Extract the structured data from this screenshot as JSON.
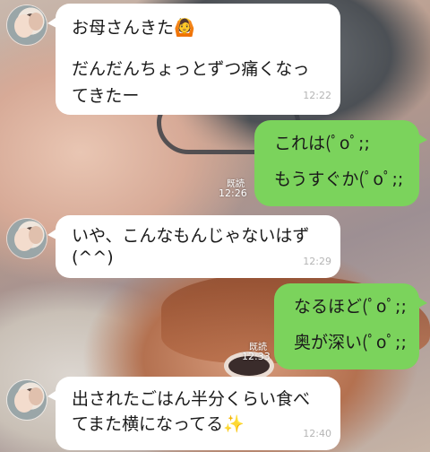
{
  "messages": [
    {
      "side": "left",
      "lines": [
        "お母さんきた🙆",
        "だんだんちょっとずつ痛くなっ",
        "てきたー"
      ],
      "time": "12:22"
    },
    {
      "side": "right",
      "lines": [
        "これは(ﾟoﾟ;;",
        "もうすぐか(ﾟoﾟ;;"
      ],
      "time": "12:26",
      "read": "既読"
    },
    {
      "side": "left",
      "lines": [
        "いや、こんなもんじゃないはず",
        "(^^)"
      ],
      "time": "12:29"
    },
    {
      "side": "right",
      "lines": [
        "なるほど(ﾟoﾟ;;",
        "奥が深い(ﾟoﾟ;;"
      ],
      "time": "12:33",
      "read": "既読"
    },
    {
      "side": "left",
      "lines": [
        "出されたごはん半分くらい食べ",
        "てまた横になってる✨"
      ],
      "time": "12:40"
    }
  ],
  "colors": {
    "incoming_bubble": "#ffffff",
    "outgoing_bubble": "#7bd35c",
    "text": "#1a1a1a"
  },
  "icons": [
    "avatar",
    "person-gesturing-ok-emoji",
    "sparkles-emoji"
  ]
}
